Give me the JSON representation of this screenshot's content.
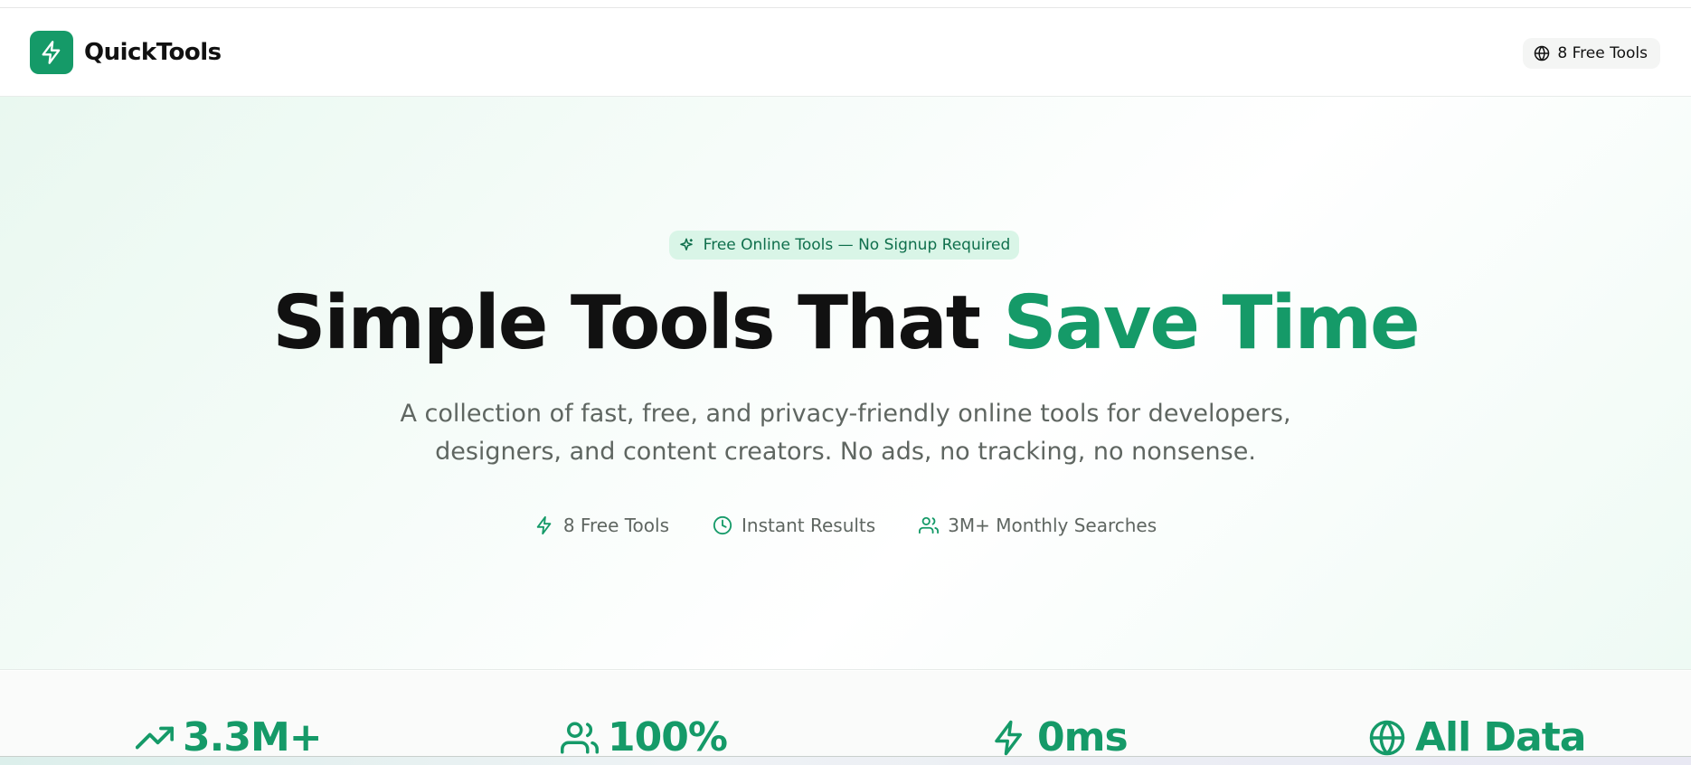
{
  "header": {
    "brand": "QuickTools",
    "logo_icon": "zap-icon",
    "tools_pill": {
      "icon": "globe-icon",
      "label": "8 Free Tools"
    }
  },
  "hero": {
    "badge": {
      "icon": "sparkles-icon",
      "label": "Free Online Tools — No Signup Required"
    },
    "headline": {
      "main": "Simple Tools That",
      "accent": "Save Time"
    },
    "subtitle_line1": "A collection of fast, free, and privacy-friendly online tools for developers,",
    "subtitle_line2": "designers, and content creators. No ads, no tracking, no nonsense.",
    "features": [
      {
        "icon": "zap-icon",
        "label": "8 Free Tools"
      },
      {
        "icon": "clock-icon",
        "label": "Instant Results"
      },
      {
        "icon": "users-icon",
        "label": "3M+ Monthly Searches"
      }
    ]
  },
  "stats": [
    {
      "icon": "trending-up-icon",
      "value": "3.3M+"
    },
    {
      "icon": "users-icon",
      "value": "100%"
    },
    {
      "icon": "zap-icon",
      "value": "0ms"
    },
    {
      "icon": "globe-icon",
      "value": "All Data"
    }
  ],
  "colors": {
    "accent": "#159a68",
    "badge_bg": "#d9f5e7",
    "text": "#111111",
    "muted": "#5f6661"
  }
}
